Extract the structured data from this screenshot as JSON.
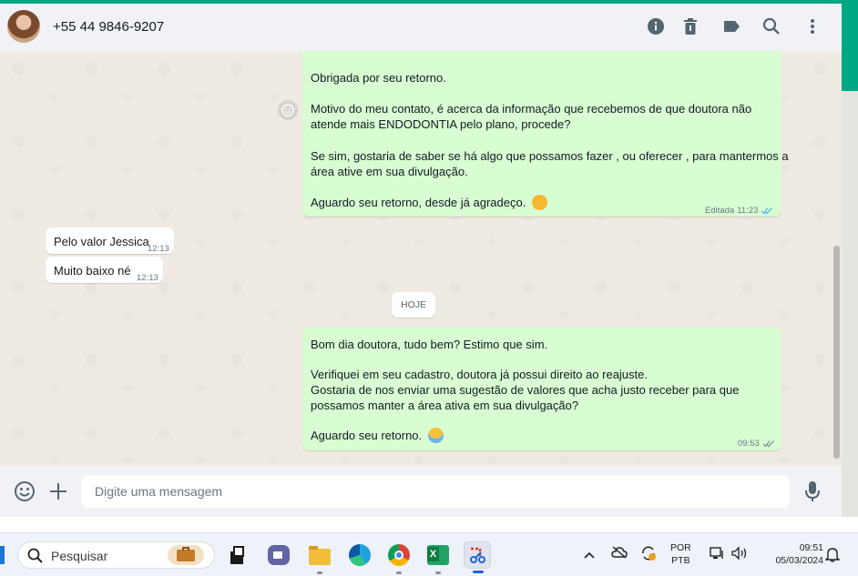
{
  "header": {
    "contact": "+55 44 9846-9207",
    "icons": [
      "info-icon",
      "trash-icon",
      "label-icon",
      "search-icon",
      "menu-icon"
    ]
  },
  "messages": {
    "msg1": {
      "p1": "Obrigada por seu retorno.",
      "p2a": "Motivo do meu  contato, é acerca da informação que recebemos de que doutora não",
      "p2b": "atende mais ENDODONTIA pelo plano, procede?",
      "p3a": "Se sim, gostaria de saber se há algo que possamos fazer , ou oferecer , para mantermos a",
      "p3b": "área ative em sua divulgação.",
      "p4": "Aguardo seu retorno, desde já agradeço.",
      "status": "Editada",
      "time": "11:23"
    },
    "in1": {
      "text": "Pelo valor Jessica",
      "time": "12:13"
    },
    "in2": {
      "text": "Muito baixo né",
      "time": "12:13"
    },
    "date_chip": "HOJE",
    "msg2": {
      "p1": "Bom dia doutora, tudo bem? Estimo que sim.",
      "p2": "Verifiquei em seu cadastro, doutora já possui direito ao reajuste.",
      "p3a": "Gostaria de nos enviar uma sugestão de valores que acha justo receber para que",
      "p3b": "possamos manter a área ativa em sua divulgação?",
      "p4": "Aguardo seu retorno.",
      "time": "09:53"
    }
  },
  "composer": {
    "placeholder": "Digite uma mensagem"
  },
  "taskbar": {
    "search_label": "Pesquisar",
    "lang_top": "POR",
    "lang_bottom": "PTB",
    "time": "09:51",
    "date": "05/03/2024"
  },
  "colors": {
    "accent": "#00a884",
    "bubble_out": "#d9fdd3",
    "bubble_in": "#ffffff",
    "tick": "#53bdeb"
  }
}
